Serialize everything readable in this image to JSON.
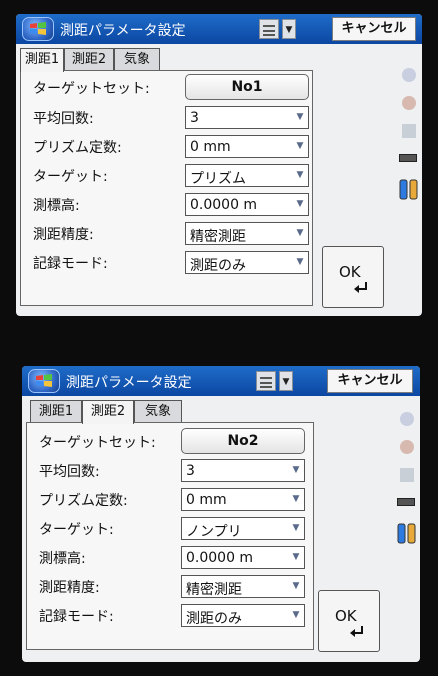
{
  "screens": [
    {
      "window_title": "測距パラメータ設定",
      "cancel_label": "キャンセル",
      "tabs": [
        {
          "label": "測距1",
          "active": true
        },
        {
          "label": "測距2",
          "active": false
        },
        {
          "label": "気象",
          "active": false
        }
      ],
      "fields": [
        {
          "label": "ターゲットセット:",
          "value": "No1",
          "type": "button"
        },
        {
          "label": "平均回数:",
          "value": "3",
          "type": "select"
        },
        {
          "label": "プリズム定数:",
          "value": "0 mm",
          "type": "select"
        },
        {
          "label": "ターゲット:",
          "value": "プリズム",
          "type": "select"
        },
        {
          "label": "測標高:",
          "value": "0.0000 m",
          "type": "select"
        },
        {
          "label": "測距精度:",
          "value": "精密測距",
          "type": "select"
        },
        {
          "label": "記録モード:",
          "value": "測距のみ",
          "type": "select"
        }
      ],
      "ok_label": "OK"
    },
    {
      "window_title": "測距パラメータ設定",
      "cancel_label": "キャンセル",
      "tabs": [
        {
          "label": "測距1",
          "active": false
        },
        {
          "label": "測距2",
          "active": true
        },
        {
          "label": "気象",
          "active": false
        }
      ],
      "fields": [
        {
          "label": "ターゲットセット:",
          "value": "No2",
          "type": "button"
        },
        {
          "label": "平均回数:",
          "value": "3",
          "type": "select"
        },
        {
          "label": "プリズム定数:",
          "value": "0 mm",
          "type": "select"
        },
        {
          "label": "ターゲット:",
          "value": "ノンプリ",
          "type": "select"
        },
        {
          "label": "測標高:",
          "value": "0.0000 m",
          "type": "select"
        },
        {
          "label": "測距精度:",
          "value": "精密測距",
          "type": "select"
        },
        {
          "label": "記録モード:",
          "value": "測距のみ",
          "type": "select"
        }
      ],
      "ok_label": "OK"
    }
  ],
  "icons": {
    "start": "windows-flag-icon",
    "keyboard": "keyboard-icon",
    "dropdown": "chevron-down-icon",
    "enter": "enter-arrow-icon",
    "battery": "battery-icon",
    "battery_pair": "dual-battery-icon"
  },
  "colors": {
    "titlebar": "#0b47a2",
    "screen_bg": "#eef0f2"
  }
}
